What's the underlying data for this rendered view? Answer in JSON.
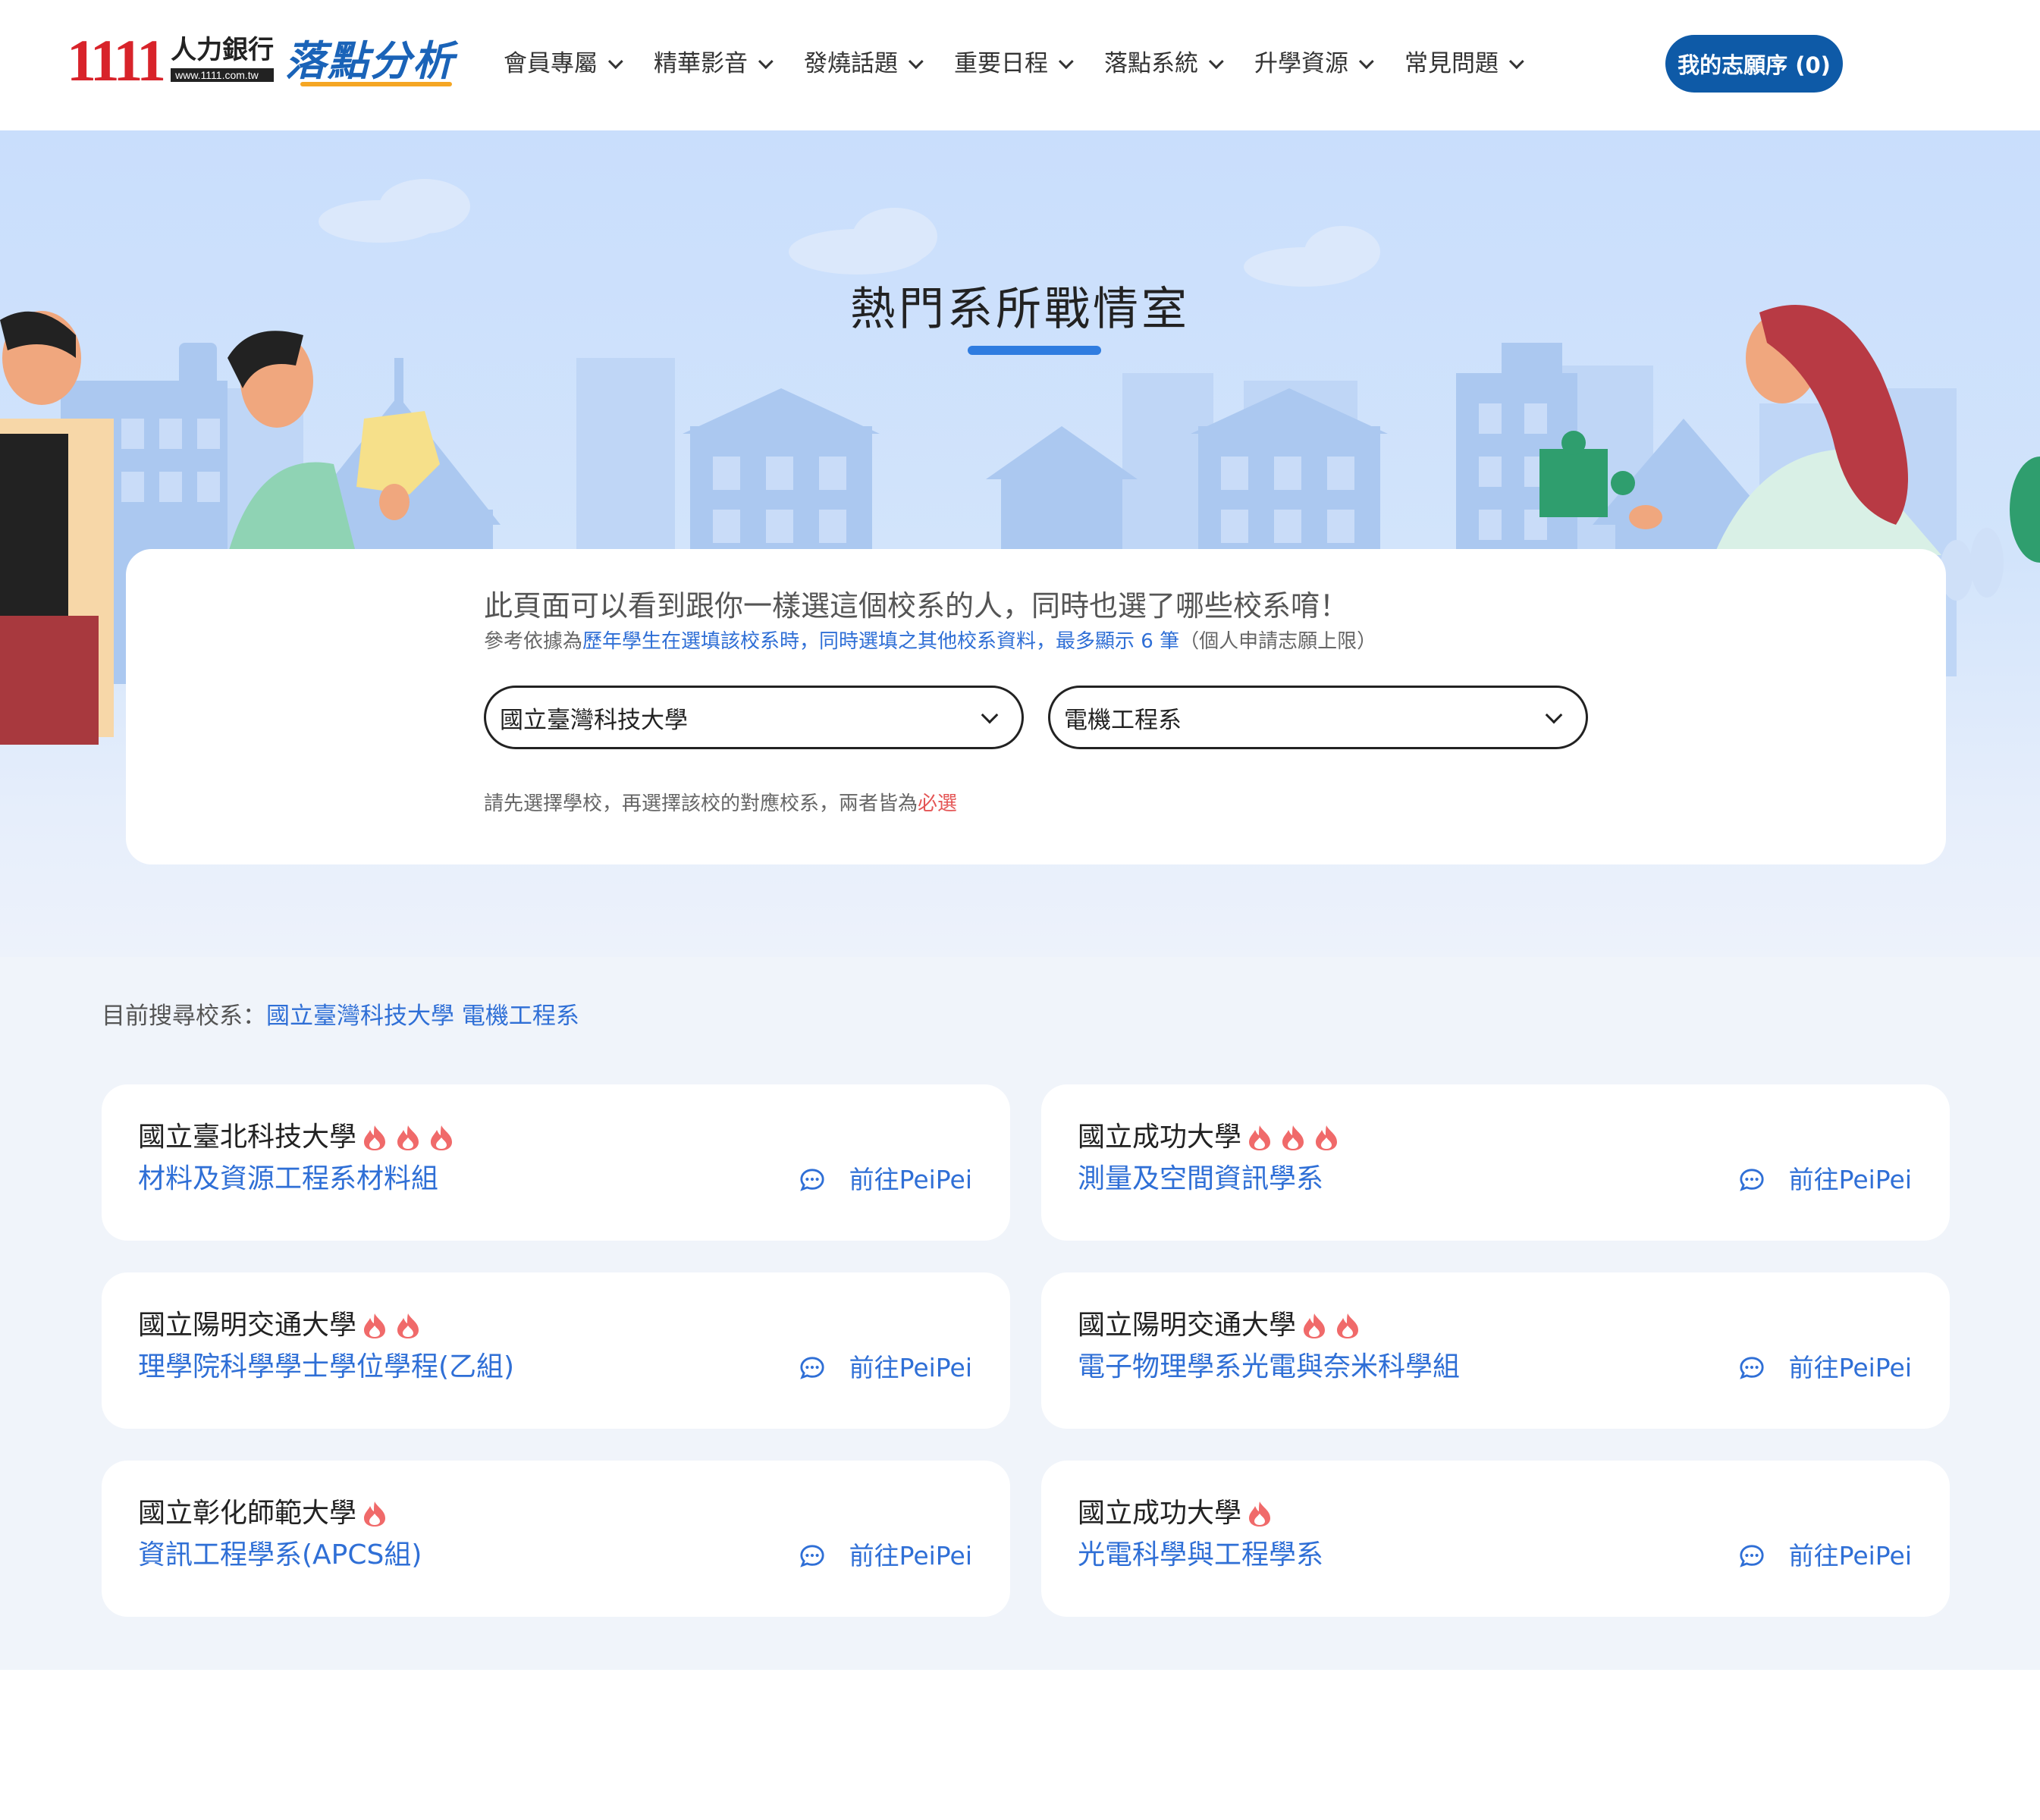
{
  "header": {
    "logo_number": "1111",
    "logo_text": "人力銀行",
    "logo_url": "www.1111.com.tw",
    "brand": "落點分析",
    "nav": [
      {
        "label": "會員專屬"
      },
      {
        "label": "精華影音"
      },
      {
        "label": "發燒話題"
      },
      {
        "label": "重要日程"
      },
      {
        "label": "落點系統"
      },
      {
        "label": "升學資源"
      },
      {
        "label": "常見問題"
      }
    ],
    "my_list_button": "我的志願序 (0)"
  },
  "hero": {
    "title": "熱門系所戰情室",
    "intro": "此頁面可以看到跟你一樣選這個校系的人，同時也選了哪些校系唷！",
    "sub_prefix": "參考依據為",
    "sub_highlight": "歷年學生在選填該校系時，同時選填之其他校系資料，最多顯示 6 筆",
    "sub_suffix": "（個人申請志願上限）",
    "school_select_value": "國立臺灣科技大學",
    "dept_select_value": "電機工程系",
    "note_prefix": "請先選擇學校，再選擇該校的對應校系，兩者皆為",
    "note_required": "必選"
  },
  "results": {
    "current_label": "目前搜尋校系：",
    "current_value": "國立臺灣科技大學 電機工程系",
    "go_label": "前往PeiPei",
    "cards": [
      {
        "school": "國立臺北科技大學",
        "dept": "材料及資源工程系材料組",
        "heat": 3
      },
      {
        "school": "國立成功大學",
        "dept": "測量及空間資訊學系",
        "heat": 3
      },
      {
        "school": "國立陽明交通大學",
        "dept": "理學院科學學士學位學程(乙組)",
        "heat": 2
      },
      {
        "school": "國立陽明交通大學",
        "dept": "電子物理學系光電與奈米科學組",
        "heat": 2
      },
      {
        "school": "國立彰化師範大學",
        "dept": "資訊工程學系(APCS組)",
        "heat": 1
      },
      {
        "school": "國立成功大學",
        "dept": "光電科學與工程學系",
        "heat": 1
      }
    ]
  },
  "colors": {
    "brand_blue": "#0e5aa7",
    "link_blue": "#2f6fd6",
    "flame_red": "#f06a6a",
    "logo_red": "#d8232a"
  }
}
